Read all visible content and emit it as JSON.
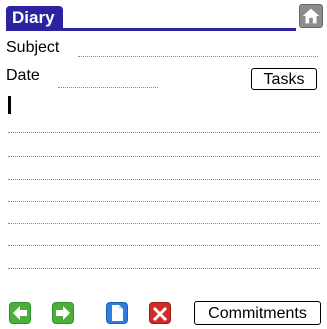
{
  "header": {
    "title": "Diary",
    "home_icon": "home-icon",
    "accent_color": "#2c23a0"
  },
  "form": {
    "subject_label": "Subject",
    "subject_value": "",
    "date_label": "Date",
    "date_value": "",
    "tasks_button": "Tasks",
    "body_text": ""
  },
  "toolbar": {
    "back_icon": "back-arrow-icon",
    "forward_icon": "forward-arrow-icon",
    "new_page_icon": "new-page-icon",
    "delete_icon": "delete-icon",
    "commitments_button": "Commitments"
  }
}
